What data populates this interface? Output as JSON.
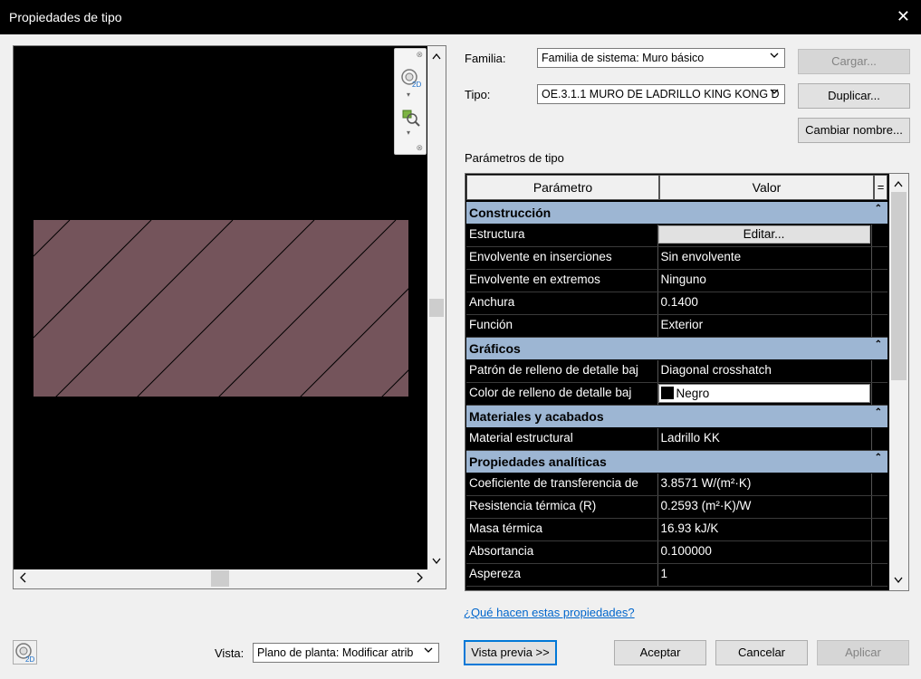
{
  "window": {
    "title": "Propiedades de tipo",
    "close_glyph": "✕"
  },
  "preview": {
    "wall_color": "#74545b",
    "scroll_up": "^",
    "scroll_down": "v",
    "scroll_left": "<",
    "scroll_right": ">",
    "nav_icons": [
      "steering-wheel-2d-icon",
      "zoom-region-icon"
    ]
  },
  "familia": {
    "label": "Familia:",
    "value": "Familia de sistema: Muro básico"
  },
  "tipo": {
    "label": "Tipo:",
    "value": "OE.3.1.1 MURO DE LADRILLO KING KONG D"
  },
  "buttons": {
    "cargar": "Cargar...",
    "duplicar": "Duplicar...",
    "cambiar_nombre": "Cambiar nombre...",
    "vista_previa": "Vista previa >>",
    "aceptar": "Aceptar",
    "cancelar": "Cancelar",
    "aplicar": "Aplicar"
  },
  "parametros_title": "Parámetros de tipo",
  "grid": {
    "col_param": "Parámetro",
    "col_valor": "Valor",
    "col_eq": "=",
    "collapse_glyph": "⌃",
    "groups": [
      {
        "name": "Construcción",
        "rows": [
          {
            "param": "Estructura",
            "value": "Editar...",
            "kind": "button"
          },
          {
            "param": "Envolvente en inserciones",
            "value": "Sin envolvente"
          },
          {
            "param": "Envolvente en extremos",
            "value": "Ninguno"
          },
          {
            "param": "Anchura",
            "value": "0.1400"
          },
          {
            "param": "Función",
            "value": "Exterior"
          }
        ]
      },
      {
        "name": "Gráficos",
        "rows": [
          {
            "param": "Patrón de relleno de detalle baj",
            "value": "Diagonal crosshatch"
          },
          {
            "param": "Color de relleno de detalle baj",
            "value": "Negro",
            "kind": "color"
          }
        ]
      },
      {
        "name": "Materiales y acabados",
        "rows": [
          {
            "param": "Material estructural",
            "value": "Ladrillo KK"
          }
        ]
      },
      {
        "name": "Propiedades analíticas",
        "rows": [
          {
            "param": "Coeficiente de transferencia de",
            "value": "3.8571 W/(m²·K)"
          },
          {
            "param": "Resistencia térmica (R)",
            "value": "0.2593 (m²·K)/W"
          },
          {
            "param": "Masa térmica",
            "value": "16.93 kJ/K"
          },
          {
            "param": "Absortancia",
            "value": "0.100000"
          },
          {
            "param": "Aspereza",
            "value": "1"
          }
        ]
      }
    ]
  },
  "help_link": "¿Qué hacen estas propiedades?",
  "vista": {
    "label": "Vista:",
    "value": "Plano de planta: Modificar atrib"
  },
  "colors": {
    "group_header": "#9db6d3",
    "link": "#0066cc",
    "accent": "#0078d7"
  }
}
